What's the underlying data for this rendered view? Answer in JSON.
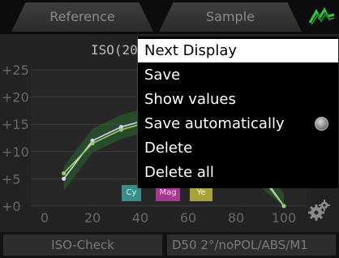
{
  "tabs": {
    "reference": "Reference",
    "sample": "Sample"
  },
  "chart": {
    "title": "ISO(20",
    "y_ticks": [
      "+25",
      "+20",
      "+15",
      "+10",
      "+5",
      "+0"
    ],
    "x_ticks": [
      "0",
      "20",
      "40",
      "60",
      "80",
      "100"
    ],
    "chips": [
      "Cy",
      "Mag",
      "Ye"
    ]
  },
  "chart_data": {
    "type": "line",
    "x": [
      8,
      20,
      32,
      44,
      56,
      68,
      80,
      92,
      100
    ],
    "ylim": [
      0,
      25
    ],
    "xlim": [
      -5,
      105
    ],
    "series": [
      {
        "values": [
          5,
          12,
          14.5,
          16,
          16.5,
          15,
          11,
          5,
          0
        ],
        "color": "#e0d0f0"
      },
      {
        "values": [
          6,
          11.5,
          14,
          15.5,
          16,
          14.5,
          10.5,
          4.5,
          0
        ],
        "color": "#8fd16a"
      }
    ],
    "band_color": "#2c6a30"
  },
  "bottom": {
    "left": "ISO-Check",
    "right": "D50 2°/noPOL/ABS/M1"
  },
  "menu": {
    "items": [
      {
        "label": "Next Display"
      },
      {
        "label": "Save"
      },
      {
        "label": "Show values"
      },
      {
        "label": "Save automatically"
      },
      {
        "label": "Delete"
      },
      {
        "label": "Delete all"
      }
    ],
    "selected_index": 0,
    "radio_item_index": 3
  },
  "colors": {
    "accent_green": "#35c63a",
    "menu_bg": "#000000",
    "menu_selected_bg": "#ffffff"
  }
}
